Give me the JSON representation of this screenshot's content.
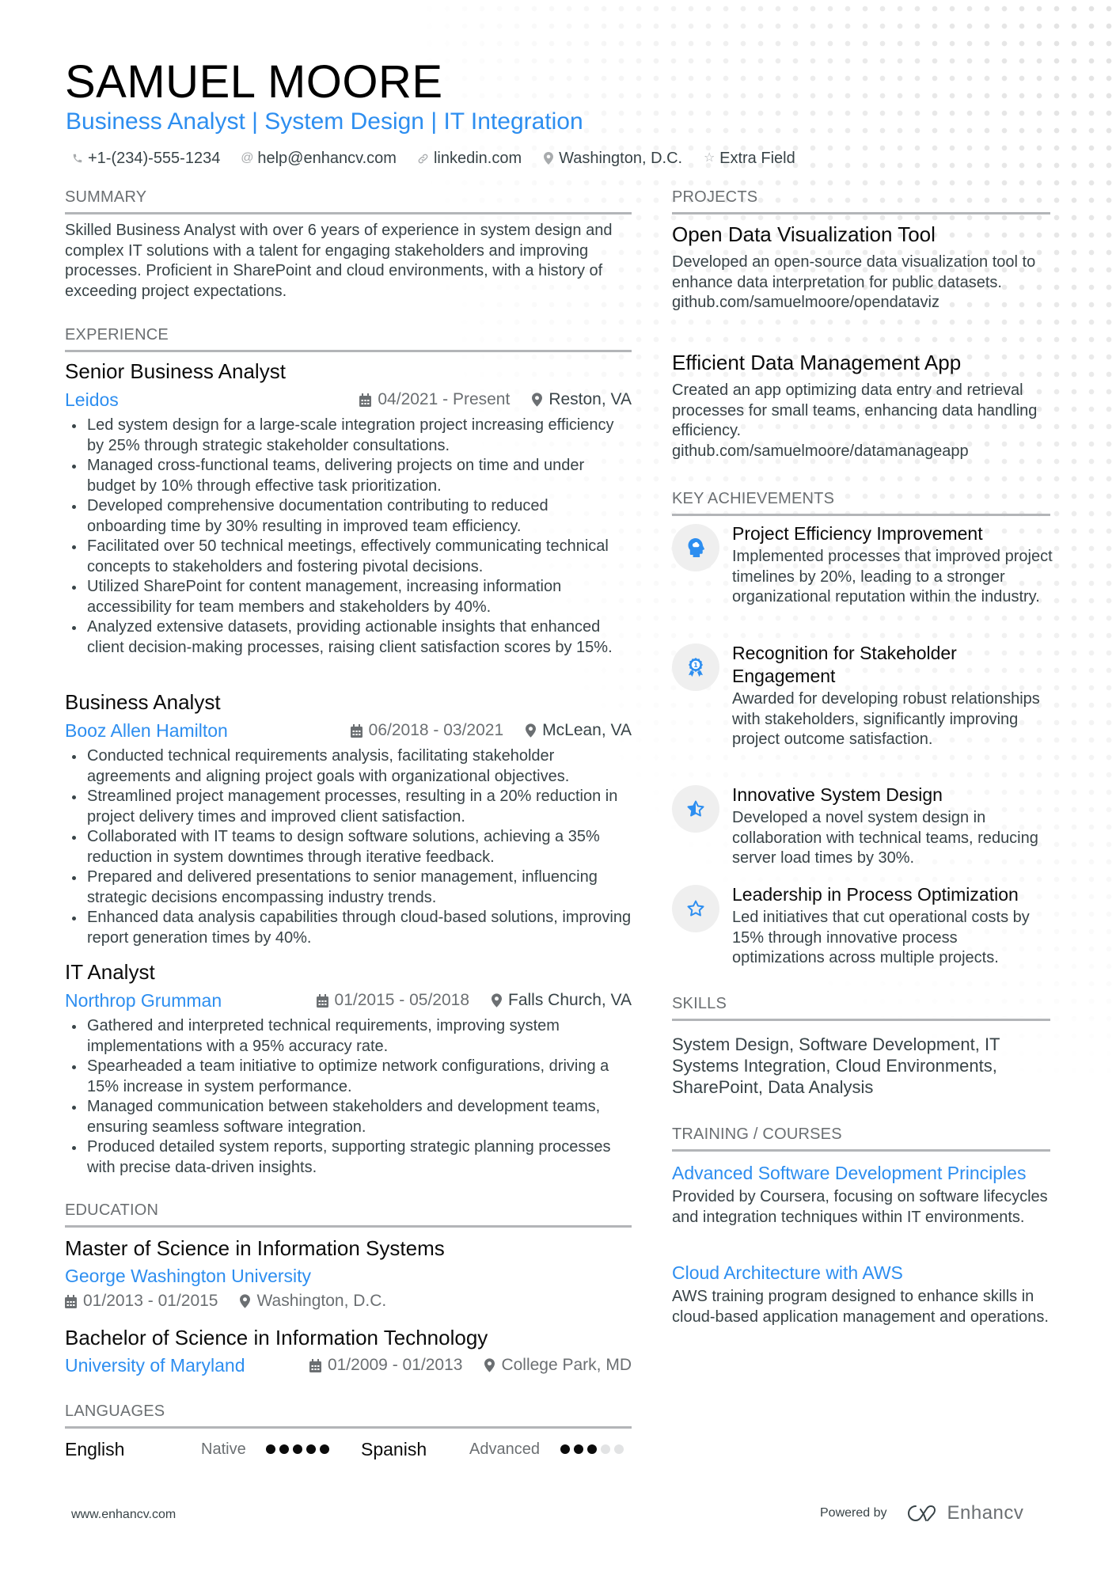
{
  "header": {
    "name": "SAMUEL MOORE",
    "subtitle": "Business Analyst | System Design | IT Integration",
    "contacts": [
      {
        "icon": "phone-icon",
        "text": "+1-(234)-555-1234"
      },
      {
        "icon": "at-icon",
        "text": "help@enhancv.com"
      },
      {
        "icon": "link-icon",
        "text": "linkedin.com"
      },
      {
        "icon": "location-pin-icon",
        "text": "Washington, D.C."
      },
      {
        "icon": "star-outline-icon",
        "text": "Extra Field"
      }
    ]
  },
  "summary": {
    "heading": "SUMMARY",
    "text": "Skilled Business Analyst with over 6 years of experience in system design and complex IT solutions with a talent for engaging stakeholders and improving processes. Proficient in SharePoint and cloud environments, with a history of exceeding project expectations."
  },
  "experience": {
    "heading": "EXPERIENCE",
    "jobs": [
      {
        "title": "Senior Business Analyst",
        "company": "Leidos",
        "dates": "04/2021 - Present",
        "location": "Reston, VA",
        "bullets": [
          "Led system design for a large-scale integration project increasing efficiency by 25% through strategic stakeholder consultations.",
          "Managed cross-functional teams, delivering projects on time and under budget by 10% through effective task prioritization.",
          "Developed comprehensive documentation contributing to reduced onboarding time by 30% resulting in improved team efficiency.",
          "Facilitated over 50 technical meetings, effectively communicating technical concepts to stakeholders and fostering pivotal decisions.",
          "Utilized SharePoint for content management, increasing information accessibility for team members and stakeholders by 40%.",
          "Analyzed extensive datasets, providing actionable insights that enhanced client decision-making processes, raising client satisfaction scores by 15%."
        ]
      },
      {
        "title": "Business Analyst",
        "company": "Booz Allen Hamilton",
        "dates": "06/2018 - 03/2021",
        "location": "McLean, VA",
        "bullets": [
          "Conducted technical requirements analysis, facilitating stakeholder agreements and aligning project goals with organizational objectives.",
          "Streamlined project management processes, resulting in a 20% reduction in project delivery times and improved client satisfaction.",
          "Collaborated with IT teams to design software solutions, achieving a 35% reduction in system downtimes through iterative feedback.",
          "Prepared and delivered presentations to senior management, influencing strategic decisions encompassing industry trends.",
          "Enhanced data analysis capabilities through cloud-based solutions, improving report generation times by 40%."
        ]
      },
      {
        "title": "IT Analyst",
        "company": "Northrop Grumman",
        "dates": "01/2015 - 05/2018",
        "location": "Falls Church, VA",
        "bullets": [
          "Gathered and interpreted technical requirements, improving system implementations with a 95% accuracy rate.",
          "Spearheaded a team initiative to optimize network configurations, driving a 15% increase in system performance.",
          "Managed communication between stakeholders and development teams, ensuring seamless software integration.",
          "Produced detailed system reports, supporting strategic planning processes with precise data-driven insights."
        ]
      }
    ]
  },
  "education": {
    "heading": "EDUCATION",
    "items": [
      {
        "degree": "Master of Science in Information Systems",
        "school": "George Washington University",
        "dates": "01/2013 - 01/2015",
        "location": "Washington, D.C."
      },
      {
        "degree": "Bachelor of Science in Information Technology",
        "school": "University of Maryland",
        "dates": "01/2009 - 01/2013",
        "location": "College Park, MD"
      }
    ]
  },
  "languages": {
    "heading": "LANGUAGES",
    "items": [
      {
        "name": "English",
        "level": "Native",
        "rating": 5,
        "max": 5
      },
      {
        "name": "Spanish",
        "level": "Advanced",
        "rating": 3,
        "max": 5
      }
    ]
  },
  "projects": {
    "heading": "PROJECTS",
    "items": [
      {
        "title": "Open Data Visualization Tool",
        "desc": "Developed an open-source data visualization tool to enhance data interpretation for public datasets.",
        "link": "github.com/samuelmoore/opendataviz"
      },
      {
        "title": "Efficient Data Management App",
        "desc": "Created an app optimizing data entry and retrieval processes for small teams, enhancing data handling efficiency.",
        "link": "github.com/samuelmoore/datamanageapp"
      }
    ]
  },
  "achievements": {
    "heading": "KEY ACHIEVEMENTS",
    "items": [
      {
        "icon": "brain-head-icon",
        "title": "Project Efficiency Improvement",
        "desc": "Implemented processes that improved project timelines by 20%, leading to a stronger organizational reputation within the industry."
      },
      {
        "icon": "award-ribbon-icon",
        "title": "Recognition for Stakeholder Engagement",
        "desc": "Awarded for developing robust relationships with stakeholders, significantly improving project outcome satisfaction."
      },
      {
        "icon": "star-half-icon",
        "title": "Innovative System Design",
        "desc": "Developed a novel system design in collaboration with technical teams, reducing server load times by 30%."
      },
      {
        "icon": "star-outline-icon",
        "title": "Leadership in Process Optimization",
        "desc": "Led initiatives that cut operational costs by 15% through innovative process optimizations across multiple projects."
      }
    ]
  },
  "skills": {
    "heading": "SKILLS",
    "text": "System Design, Software Development, IT Systems Integration, Cloud Environments, SharePoint, Data Analysis"
  },
  "training": {
    "heading": "TRAINING / COURSES",
    "items": [
      {
        "title": "Advanced Software Development Principles",
        "desc": "Provided by Coursera, focusing on software lifecycles and integration techniques within IT environments."
      },
      {
        "title": "Cloud Architecture with AWS",
        "desc": "AWS training program designed to enhance skills in cloud-based application management and operations."
      }
    ]
  },
  "footer": {
    "website": "www.enhancv.com",
    "powered_by": "Powered by",
    "brand": "Enhancv"
  },
  "colors": {
    "accent": "#2d8ef0",
    "text": "#384347",
    "heading": "#6b6f72",
    "rule": "#b3b5b8"
  }
}
